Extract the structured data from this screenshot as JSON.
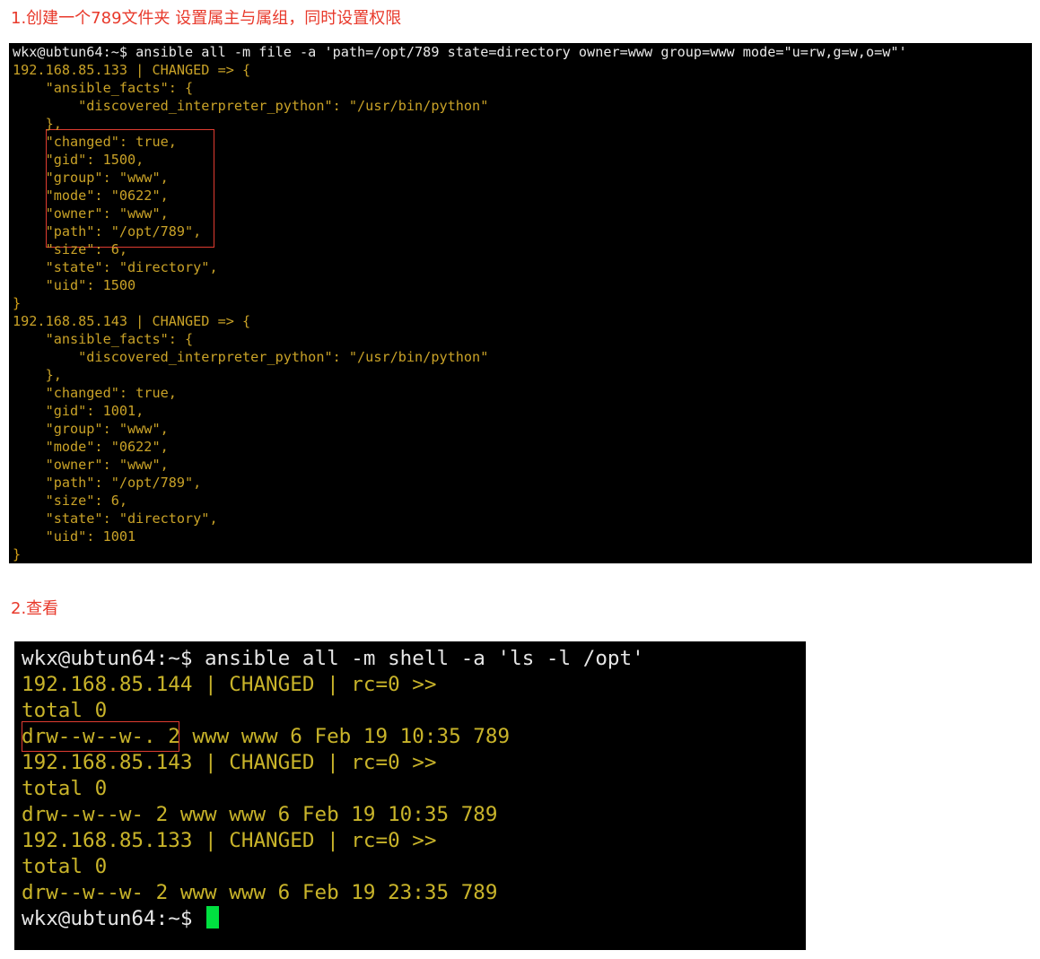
{
  "headings": {
    "step1": "1.创建一个789文件夹 设置属主与属组，同时设置权限",
    "step2": "2.查看"
  },
  "terminal1": {
    "lines": [
      {
        "text": "wkx@ubtun64:~$ ansible all -m file -a 'path=/opt/789 state=directory owner=www group=www mode=\"u=rw,g=w,o=w\"'",
        "kind": "cmd"
      },
      {
        "text": "192.168.85.133 | CHANGED => {",
        "kind": "out"
      },
      {
        "text": "    \"ansible_facts\": {",
        "kind": "out"
      },
      {
        "text": "        \"discovered_interpreter_python\": \"/usr/bin/python\"",
        "kind": "out"
      },
      {
        "text": "    },",
        "kind": "out"
      },
      {
        "text": "    \"changed\": true,",
        "kind": "out"
      },
      {
        "text": "    \"gid\": 1500,",
        "kind": "out"
      },
      {
        "text": "    \"group\": \"www\",",
        "kind": "out"
      },
      {
        "text": "    \"mode\": \"0622\",",
        "kind": "out"
      },
      {
        "text": "    \"owner\": \"www\",",
        "kind": "out"
      },
      {
        "text": "    \"path\": \"/opt/789\",",
        "kind": "out"
      },
      {
        "text": "    \"size\": 6,",
        "kind": "out"
      },
      {
        "text": "    \"state\": \"directory\",",
        "kind": "out"
      },
      {
        "text": "    \"uid\": 1500",
        "kind": "out"
      },
      {
        "text": "}",
        "kind": "brace"
      },
      {
        "text": "192.168.85.143 | CHANGED => {",
        "kind": "out"
      },
      {
        "text": "    \"ansible_facts\": {",
        "kind": "out"
      },
      {
        "text": "        \"discovered_interpreter_python\": \"/usr/bin/python\"",
        "kind": "out"
      },
      {
        "text": "    },",
        "kind": "out"
      },
      {
        "text": "    \"changed\": true,",
        "kind": "out"
      },
      {
        "text": "    \"gid\": 1001,",
        "kind": "out"
      },
      {
        "text": "    \"group\": \"www\",",
        "kind": "out"
      },
      {
        "text": "    \"mode\": \"0622\",",
        "kind": "out"
      },
      {
        "text": "    \"owner\": \"www\",",
        "kind": "out"
      },
      {
        "text": "    \"path\": \"/opt/789\",",
        "kind": "out"
      },
      {
        "text": "    \"size\": 6,",
        "kind": "out"
      },
      {
        "text": "    \"state\": \"directory\",",
        "kind": "out"
      },
      {
        "text": "    \"uid\": 1001",
        "kind": "out"
      },
      {
        "text": "}",
        "kind": "brace"
      }
    ]
  },
  "terminal2": {
    "lines": [
      {
        "text": "wkx@ubtun64:~$ ansible all -m shell -a 'ls -l /opt'",
        "kind": "cmd"
      },
      {
        "text": "192.168.85.144 | CHANGED | rc=0 >>",
        "kind": "out"
      },
      {
        "text": "total 0",
        "kind": "out"
      },
      {
        "text": "drw--w--w-. 2 www www 6 Feb 19 10:35 789",
        "kind": "out"
      },
      {
        "text": "192.168.85.143 | CHANGED | rc=0 >>",
        "kind": "out"
      },
      {
        "text": "total 0",
        "kind": "out"
      },
      {
        "text": "drw--w--w- 2 www www 6 Feb 19 10:35 789",
        "kind": "out"
      },
      {
        "text": "192.168.85.133 | CHANGED | rc=0 >>",
        "kind": "out"
      },
      {
        "text": "total 0",
        "kind": "out"
      },
      {
        "text": "drw--w--w- 2 www www 6 Feb 19 23:35 789",
        "kind": "out"
      },
      {
        "text": "wkx@ubtun64:~$ ",
        "kind": "prompt"
      }
    ]
  },
  "colors": {
    "heading": "#e8392b",
    "terminal_bg": "#000000",
    "command_text": "#e8e8e8",
    "output_text": "#c9a227",
    "highlight_box": "#e03c31",
    "cursor": "#00e040"
  }
}
